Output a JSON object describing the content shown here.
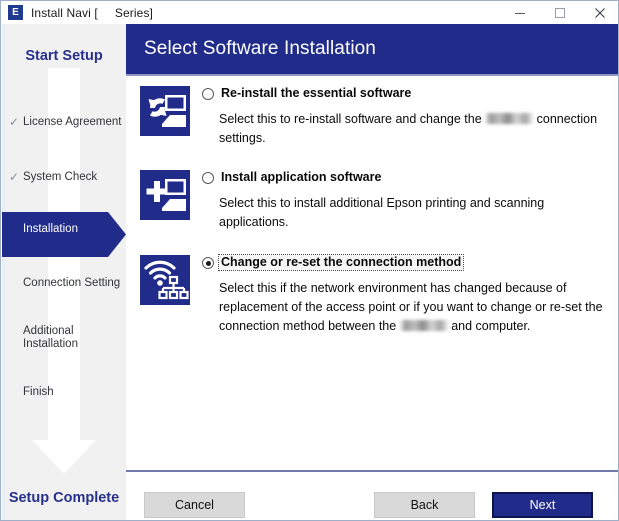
{
  "window": {
    "title": "Install Navi [     Series]",
    "app_icon": "epson-e-icon",
    "controls": {
      "minimize": "minimize-icon",
      "maximize": "maximize-icon",
      "close": "close-icon"
    }
  },
  "colors": {
    "brand_blue": "#212c8a",
    "sidebar_bg": "#f1f1f1",
    "button_gray": "#d9d9d9",
    "header_text": "#ffffff"
  },
  "sidebar": {
    "start_label": "Start Setup",
    "complete_label": "Setup Complete",
    "items": [
      {
        "label": "License Agreement",
        "check": "✓",
        "done": true,
        "active": false
      },
      {
        "label": "System Check",
        "check": "✓",
        "done": true,
        "active": false
      },
      {
        "label": "Installation",
        "check": "",
        "done": false,
        "active": true
      },
      {
        "label": "Connection Setting",
        "check": "",
        "done": false,
        "active": false
      },
      {
        "label": "Additional\nInstallation",
        "check": "",
        "done": false,
        "active": false
      },
      {
        "label": "Finish",
        "check": "",
        "done": false,
        "active": false
      }
    ]
  },
  "header": {
    "title": "Select Software Installation"
  },
  "options": [
    {
      "icon": "reinstall-software-icon",
      "title": "Re-install the essential software",
      "selected": false,
      "focused": false,
      "desc_before": "Select this to re-install software and change the",
      "desc_after": "connection settings."
    },
    {
      "icon": "install-application-icon",
      "title": "Install application software",
      "selected": false,
      "focused": false,
      "desc_before": "Select this to install additional Epson printing and scanning applications.",
      "desc_after": ""
    },
    {
      "icon": "network-connection-icon",
      "title": "Change or re-set the connection method",
      "selected": true,
      "focused": true,
      "desc_before": "Select this if the network environment has changed because of replacement of the access point or if you want to change or re-set the connection method between the",
      "desc_after": "and computer."
    }
  ],
  "footer": {
    "cancel_label": "Cancel",
    "back_label": "Back",
    "next_label": "Next"
  }
}
